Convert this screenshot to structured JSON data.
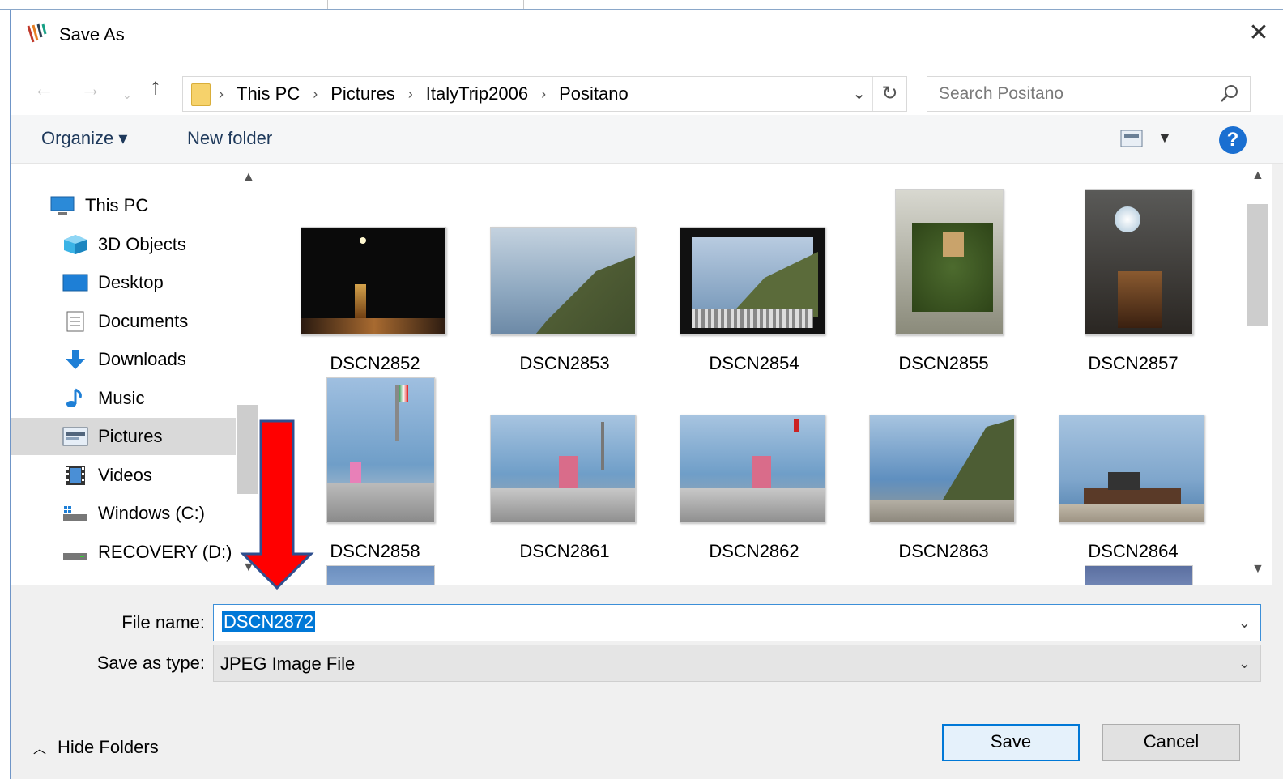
{
  "window": {
    "title": "Save As"
  },
  "address": {
    "crumbs": [
      "This PC",
      "Pictures",
      "ItalyTrip2006",
      "Positano"
    ]
  },
  "search": {
    "placeholder": "Search Positano"
  },
  "toolbar": {
    "organize_label": "Organize ▾",
    "new_folder_label": "New folder"
  },
  "nav": {
    "items": [
      {
        "label": "This PC",
        "icon": "pc-icon"
      },
      {
        "label": "3D Objects",
        "icon": "cube-icon"
      },
      {
        "label": "Desktop",
        "icon": "desktop-icon"
      },
      {
        "label": "Documents",
        "icon": "document-icon"
      },
      {
        "label": "Downloads",
        "icon": "download-icon"
      },
      {
        "label": "Music",
        "icon": "music-icon"
      },
      {
        "label": "Pictures",
        "icon": "pictures-icon",
        "selected": true
      },
      {
        "label": "Videos",
        "icon": "video-icon"
      },
      {
        "label": "Windows (C:)",
        "icon": "drive-icon"
      },
      {
        "label": "RECOVERY (D:)",
        "icon": "drive-icon"
      }
    ]
  },
  "files": [
    {
      "name": "DSCN2852"
    },
    {
      "name": "DSCN2853"
    },
    {
      "name": "DSCN2854"
    },
    {
      "name": "DSCN2855"
    },
    {
      "name": "DSCN2857"
    },
    {
      "name": "DSCN2858"
    },
    {
      "name": "DSCN2861"
    },
    {
      "name": "DSCN2862"
    },
    {
      "name": "DSCN2863"
    },
    {
      "name": "DSCN2864"
    }
  ],
  "form": {
    "file_name_label": "File name:",
    "file_name_value": "DSCN2872",
    "save_type_label": "Save as type:",
    "save_type_value": "JPEG Image File"
  },
  "footer": {
    "hide_folders_label": "Hide Folders",
    "save_label": "Save",
    "cancel_label": "Cancel"
  },
  "colors": {
    "accent": "#0078d7",
    "annotation": "#ff0000",
    "selection": "#d9d9d9"
  }
}
